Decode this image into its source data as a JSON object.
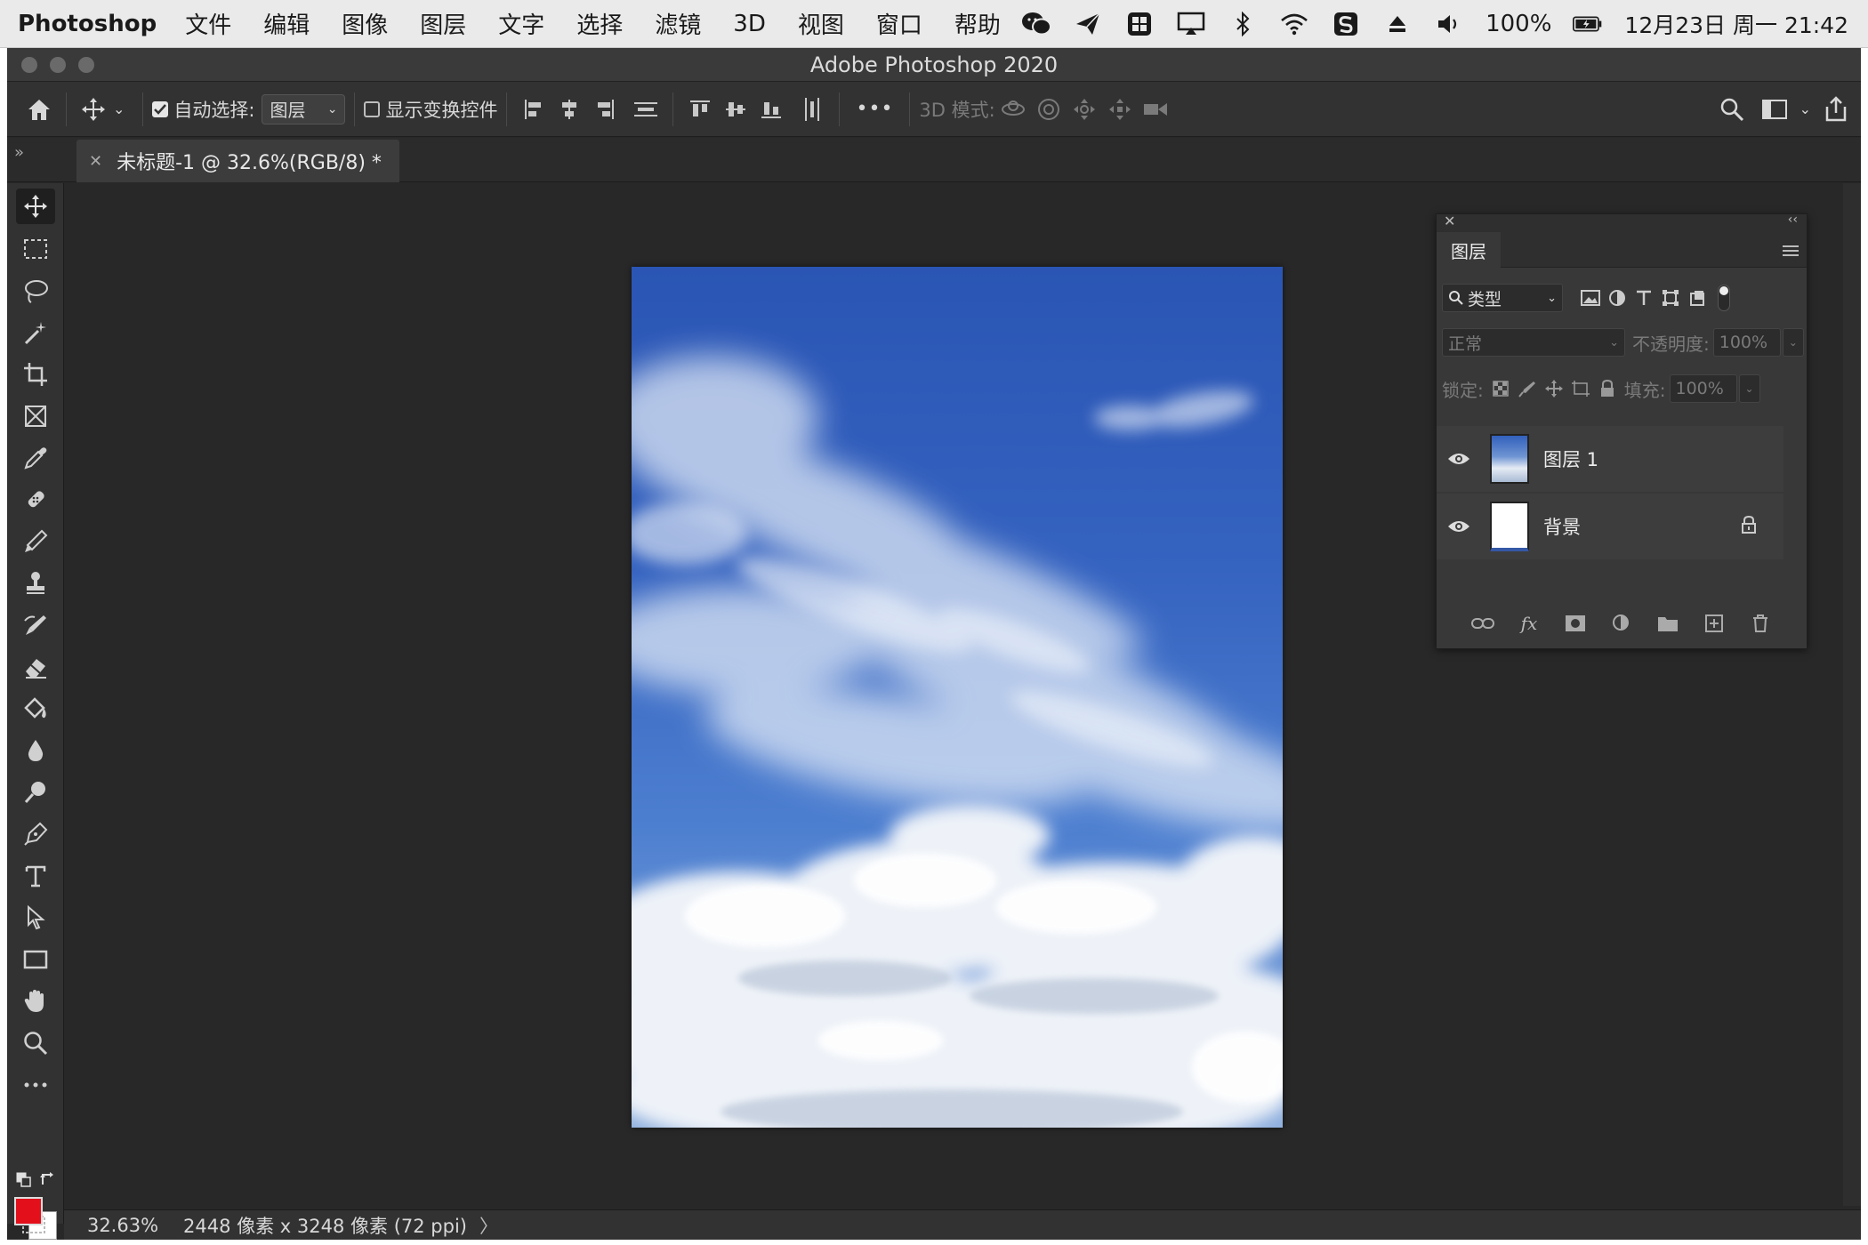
{
  "menubar": {
    "app_name": "Photoshop",
    "items": [
      "文件",
      "编辑",
      "图像",
      "图层",
      "文字",
      "选择",
      "滤镜",
      "3D",
      "视图",
      "窗口",
      "帮助"
    ],
    "battery": "100%",
    "clock": "12月23日 周一 21:42",
    "status_icons": [
      "wechat-icon",
      "paper-plane-icon",
      "grid-app-icon",
      "airplay-icon",
      "bluetooth-icon",
      "wifi-icon",
      "sogou-input-icon",
      "eject-icon",
      "volume-icon",
      "battery-icon"
    ]
  },
  "window": {
    "title": "Adobe Photoshop 2020"
  },
  "options_bar": {
    "auto_select_label": "自动选择:",
    "auto_select_checked": true,
    "auto_select_target": "图层",
    "show_transform_label": "显示变换控件",
    "show_transform_checked": false,
    "more_label": "•••",
    "mode_3d_label": "3D 模式:"
  },
  "document_tab": {
    "title": "未标题-1 @ 32.6%(RGB/8) *"
  },
  "toolbox": {
    "tools": [
      "move-tool",
      "marquee-tool",
      "lasso-tool",
      "magic-wand-tool",
      "crop-tool",
      "frame-tool",
      "eyedropper-tool",
      "healing-brush-tool",
      "brush-tool",
      "clone-stamp-tool",
      "history-brush-tool",
      "eraser-tool",
      "paint-bucket-tool",
      "blur-tool",
      "dodge-tool",
      "pen-tool",
      "type-tool",
      "path-selection-tool",
      "rectangle-tool",
      "hand-tool",
      "zoom-tool",
      "more-tools"
    ],
    "foreground_color": "#e3101c",
    "background_color": "#ffffff"
  },
  "status_bar": {
    "zoom": "32.63%",
    "doc_info": "2448 像素 x 3248 像素 (72 ppi)",
    "arrow": "〉"
  },
  "layers_panel": {
    "tab_label": "图层",
    "filter_label": "类型",
    "blend_mode": "正常",
    "opacity_label": "不透明度:",
    "opacity_value": "100%",
    "lock_label": "锁定:",
    "fill_label": "填充:",
    "fill_value": "100%",
    "layers": [
      {
        "name": "图层 1",
        "visible": true,
        "locked": false
      },
      {
        "name": "背景",
        "visible": true,
        "locked": true
      }
    ],
    "footer_fx": "fx"
  }
}
